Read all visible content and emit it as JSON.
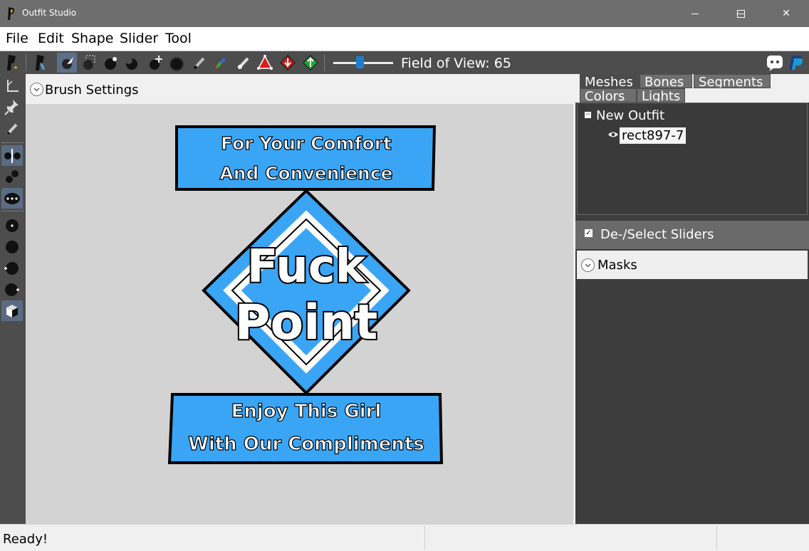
{
  "window": {
    "title": "Outfit Studio",
    "minimize_glyph": "—",
    "maximize_glyph": "☐",
    "close_glyph": "✕"
  },
  "menu": [
    "File",
    "Edit",
    "Shape",
    "Slider",
    "Tool"
  ],
  "toolbar": {
    "field_of_view": "Field of View: 65",
    "fov_value": 65,
    "icons": [
      "outfit-star-icon",
      "outfit-brush-icon",
      "select-icon",
      "box-select-icon",
      "sphere-brush-icon",
      "crescent-brush-icon",
      "move-icon",
      "gear-brush-icon",
      "wand-icon",
      "color-wand-icon",
      "alpha-brush-icon",
      "triangle-red-icon",
      "diamond-red-icon",
      "diamond-green-icon"
    ],
    "right_icons": [
      "discord-icon",
      "paypal-icon"
    ]
  },
  "left_tools": [
    "anchor-icon",
    "pin-icon",
    "pencil-icon",
    "split-icon",
    "dots-icon",
    "ellipsis-icon",
    "point-icon",
    "solid-circle-icon",
    "left-dot-icon",
    "right-dot-icon",
    "cube-icon"
  ],
  "brush_settings": {
    "label": "Brush Settings"
  },
  "artwork": {
    "top_line1": "For Your Comfort",
    "top_line2": "And Convenience",
    "center_line1": "Fuck",
    "center_line2": "Point",
    "bottom_line1": "Enjoy This Girl",
    "bottom_line2": "With Our Compliments",
    "fill_color": "#3aa5f5",
    "stroke_color": "#000000"
  },
  "right_panel": {
    "tabs": [
      "Meshes",
      "Bones",
      "Segments",
      "Colors",
      "Lights"
    ],
    "active_tab": "Meshes",
    "tree": {
      "root": "New Outfit",
      "expander": "−",
      "child": "rect897-7"
    },
    "sliders": {
      "checkbox": "✓",
      "label": "De-/Select Sliders"
    },
    "masks": {
      "label": "Masks"
    }
  },
  "status": {
    "text": "Ready!"
  }
}
